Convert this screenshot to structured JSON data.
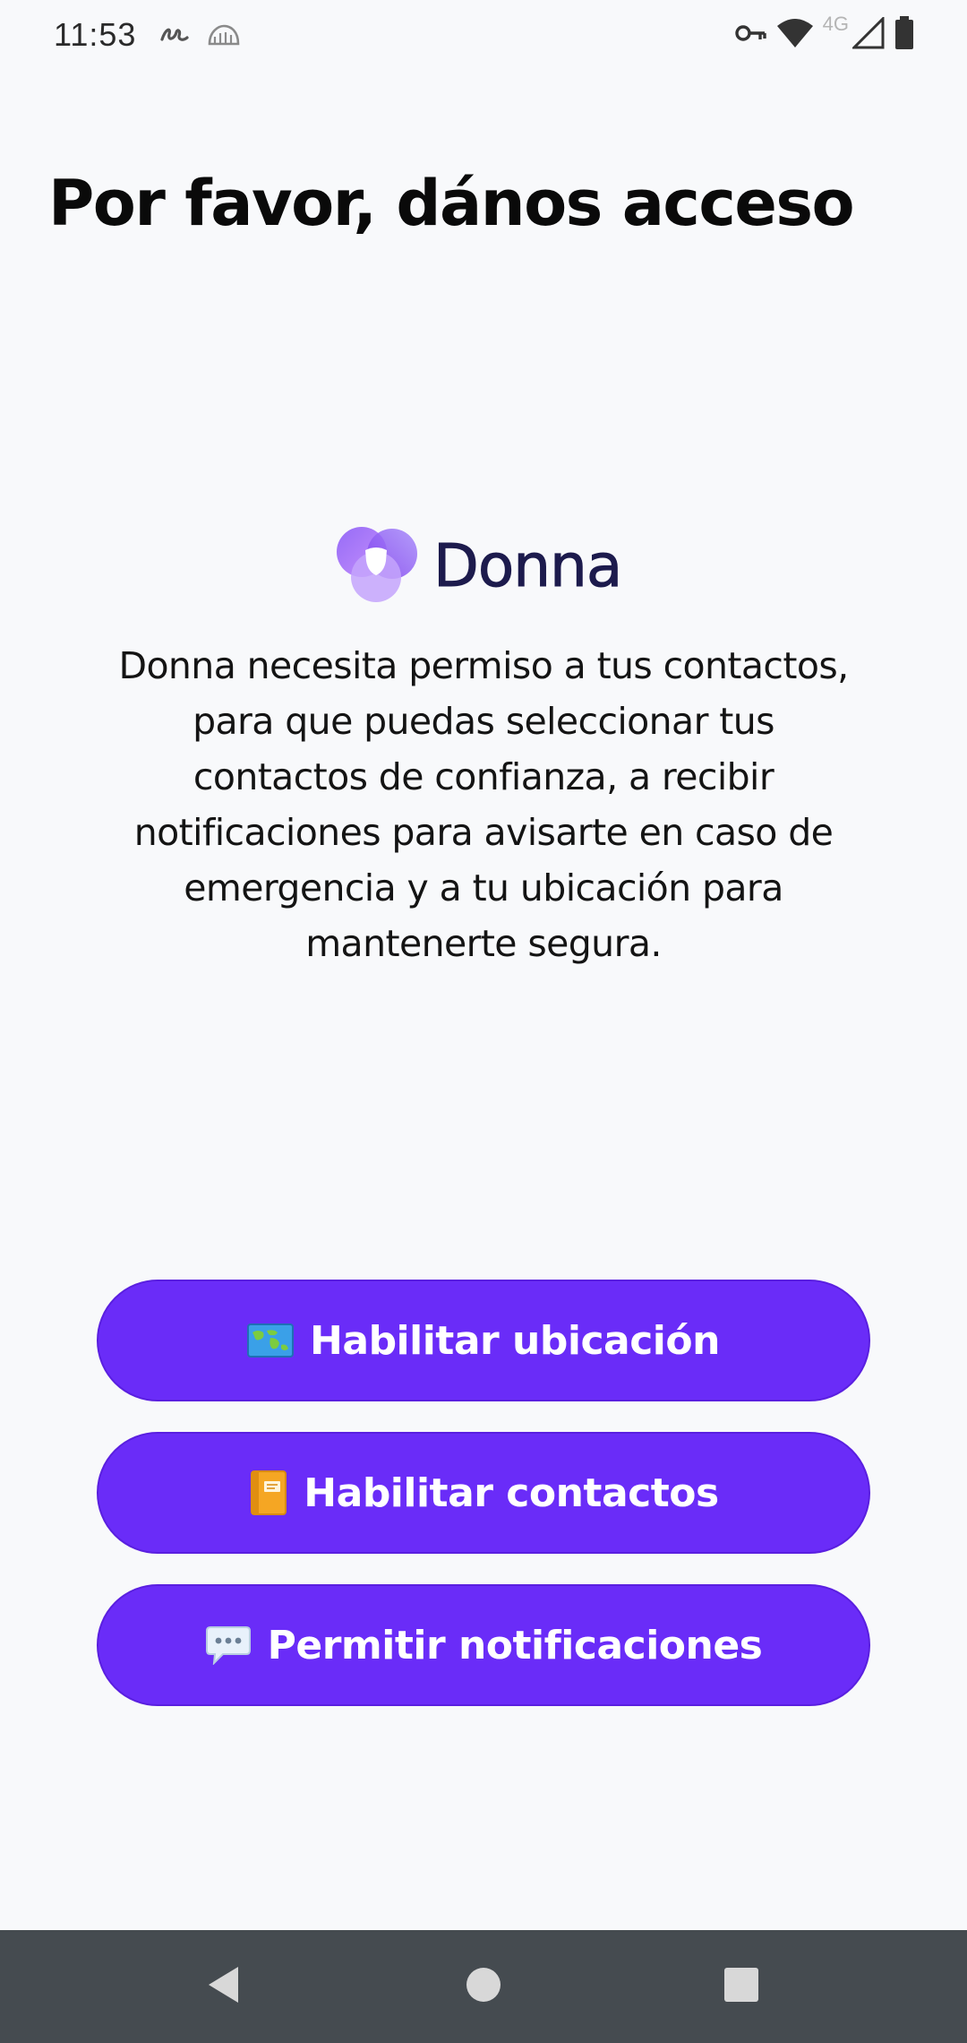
{
  "status_bar": {
    "time": "11:53",
    "network_label": "4G",
    "left_icons": [
      "signature-icon",
      "android-debug-icon"
    ],
    "right_icons": [
      "key-icon",
      "wifi-icon",
      "cell-signal-icon",
      "battery-icon"
    ]
  },
  "header": {
    "title": "Por favor, dános acceso"
  },
  "brand": {
    "name": "Donna",
    "logo_icon": "donna-shield-logo-icon",
    "name_color": "#1d1b4d"
  },
  "description": "Donna necesita permiso a tus contactos, para que puedas seleccionar tus contactos de confianza, a recibir notificaciones para avisarte en caso de emergencia y a tu ubicación para mantenerte segura.",
  "actions": [
    {
      "label": "Habilitar ubicación",
      "icon": "world-map-icon"
    },
    {
      "label": "Habilitar contactos",
      "icon": "notebook-icon"
    },
    {
      "label": "Permitir notificaciones",
      "icon": "speech-bubble-icon"
    }
  ],
  "colors": {
    "accent": "#6a2cf8",
    "background": "#f8f9fb",
    "nav_bar": "#454b50"
  },
  "nav_bar": {
    "buttons": [
      "back-icon",
      "home-icon",
      "recents-icon"
    ]
  }
}
